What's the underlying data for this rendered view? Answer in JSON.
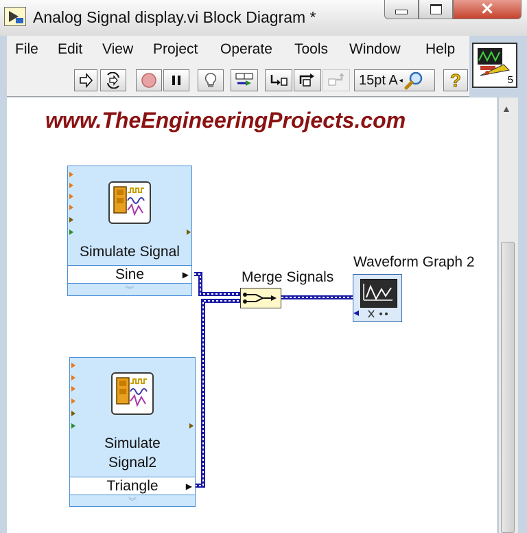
{
  "window": {
    "title": "Analog Signal display.vi Block Diagram *"
  },
  "menu": {
    "items": [
      "File",
      "Edit",
      "View",
      "Project",
      "Operate",
      "Tools",
      "Window",
      "Help"
    ]
  },
  "toolbar": {
    "font_label": "15pt A",
    "icons": [
      "run-arrow-icon",
      "run-continuously-icon",
      "abort-icon",
      "pause-icon",
      "highlight-execution-icon",
      "retain-wire-values-icon",
      "step-into-icon",
      "step-over-icon",
      "step-out-icon",
      "text-settings-icon",
      "search-icon",
      "help-icon"
    ]
  },
  "vi_icon": {
    "number": "5"
  },
  "diagram": {
    "watermark": "www.TheEngineeringProjects.com",
    "sim1": {
      "title": "Simulate Signal",
      "field": "Sine"
    },
    "sim2": {
      "title_line1": "Simulate",
      "title_line2": "Signal2",
      "field": "Triangle"
    },
    "merge_label": "Merge Signals",
    "graph_label": "Waveform Graph 2"
  },
  "colors": {
    "wire": "#1a1aa8",
    "block_fill": "#cce6fb",
    "watermark": "#8b1212"
  }
}
